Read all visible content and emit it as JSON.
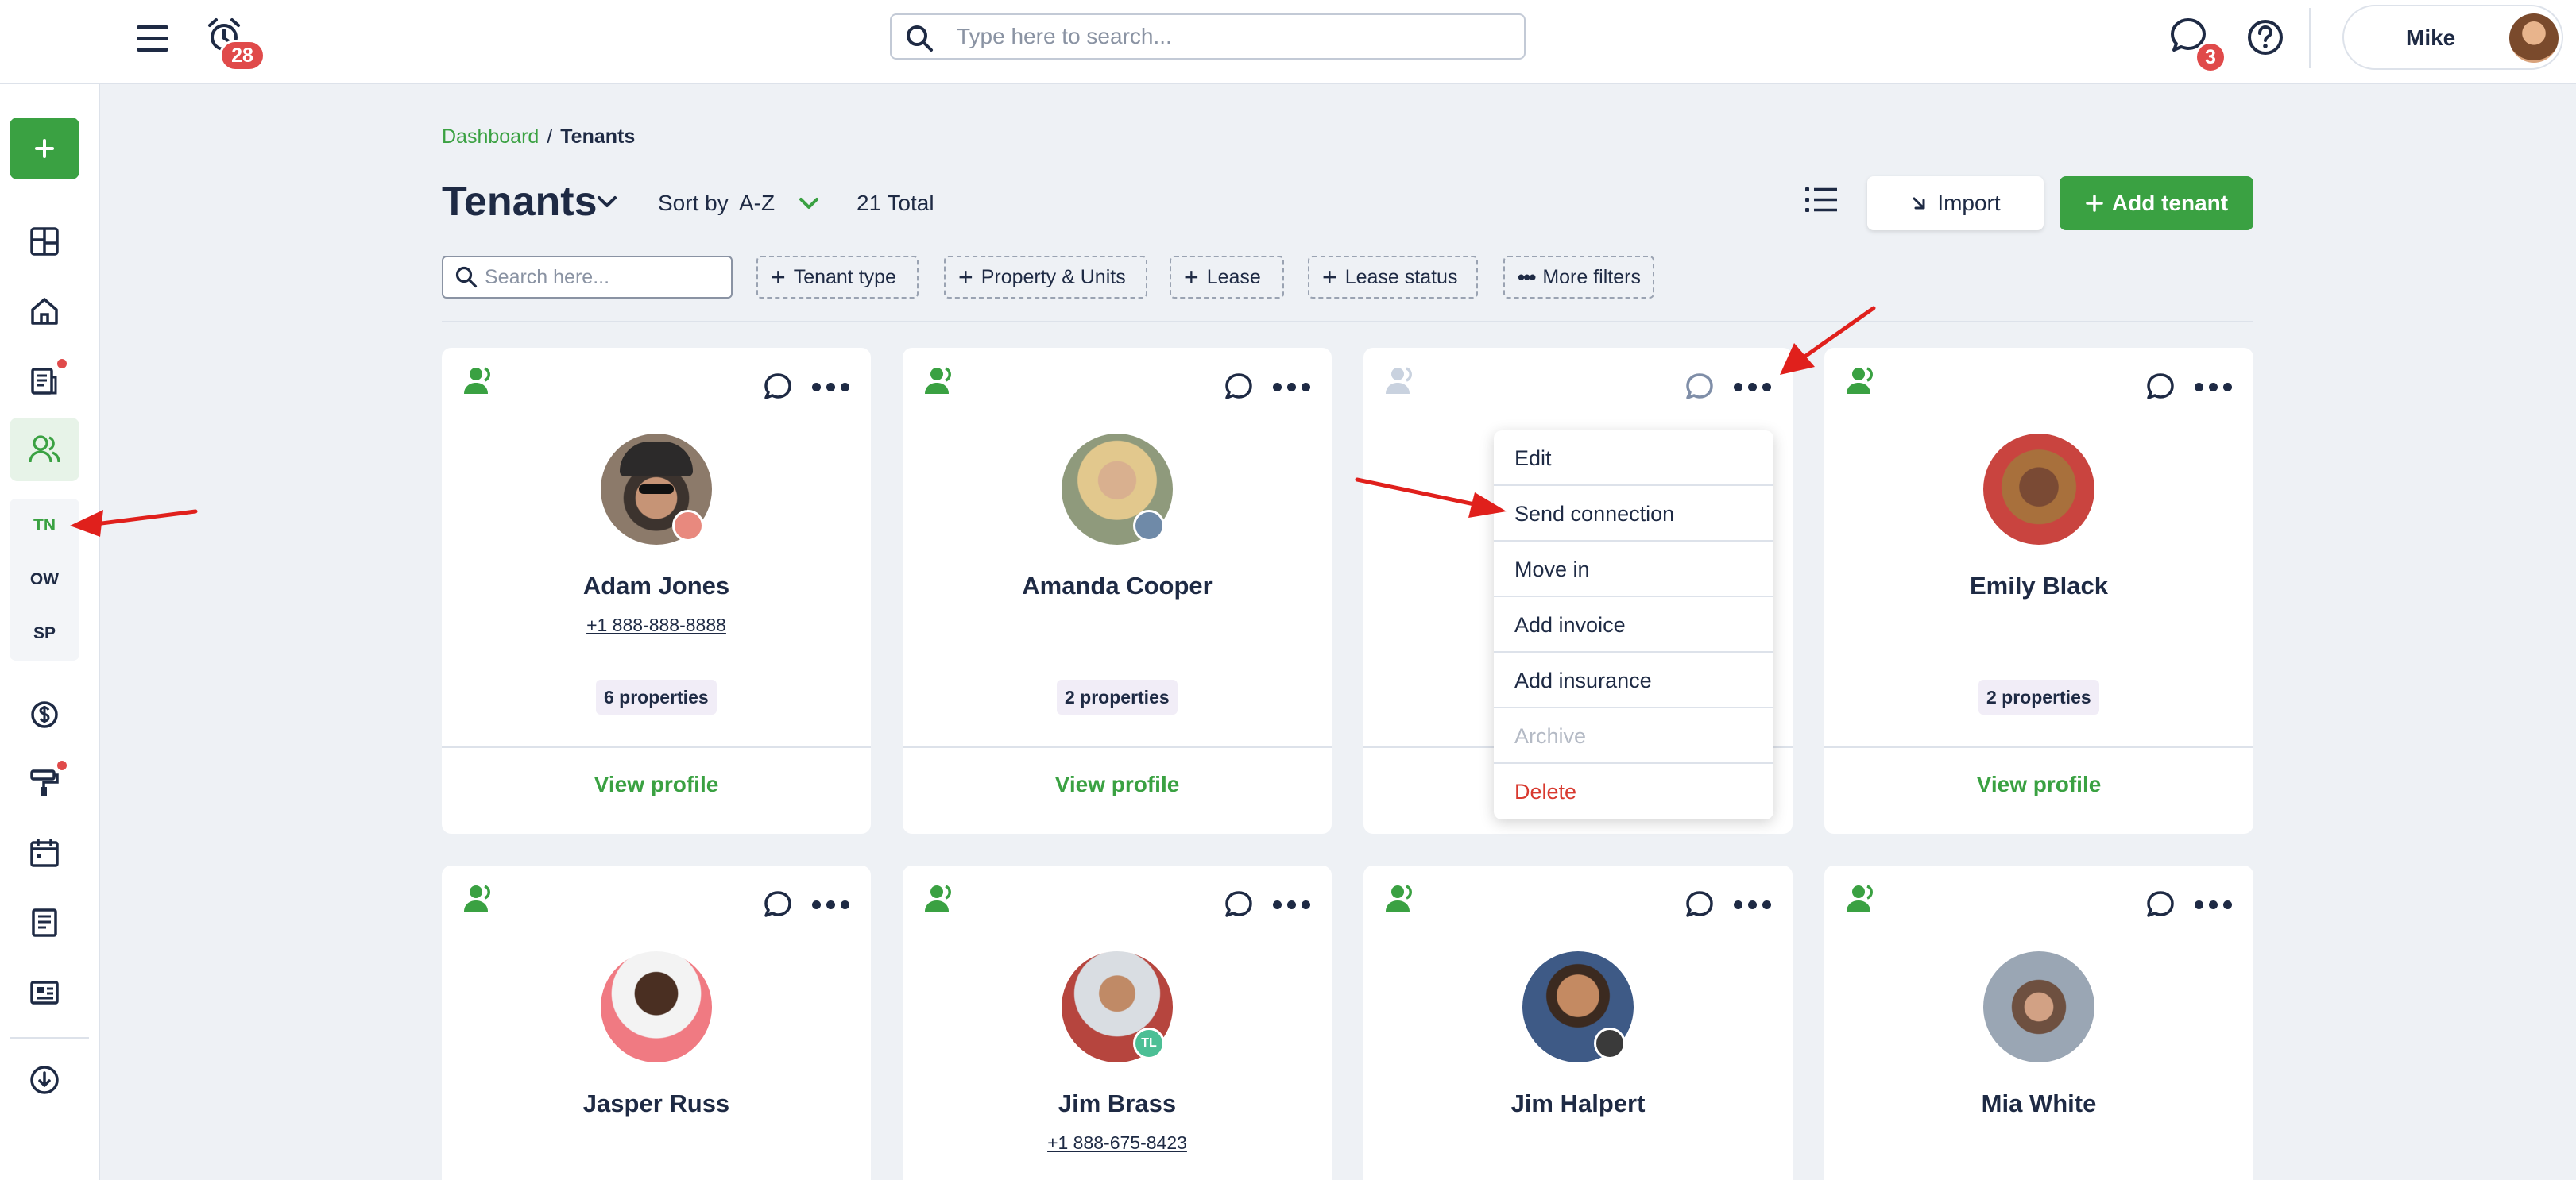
{
  "topbar": {
    "alarm_count": "28",
    "search_placeholder": "Type here to search...",
    "messages_count": "3",
    "user_name": "Mike"
  },
  "sidebar": {
    "sub_items": [
      "TN",
      "OW",
      "SP"
    ]
  },
  "breadcrumb": {
    "home": "Dashboard",
    "separator": "/",
    "current": "Tenants"
  },
  "header": {
    "title": "Tenants",
    "sort_label": "Sort by",
    "sort_value": "A-Z",
    "total": "21 Total",
    "import_label": "Import",
    "add_label": "Add tenant"
  },
  "filters": {
    "search_placeholder": "Search here...",
    "chips": [
      "Tenant type",
      "Property & Units",
      "Lease",
      "Lease status",
      "More filters"
    ]
  },
  "cards": [
    {
      "name": "Adam Jones",
      "phone": "+1 888-888-8888",
      "properties": "6 properties",
      "view": "View profile"
    },
    {
      "name": "Amanda Cooper",
      "phone": "",
      "properties": "2 properties",
      "view": "View profile"
    },
    {
      "name": "",
      "phone": "",
      "properties": "",
      "view": ""
    },
    {
      "name": "Emily Black",
      "phone": "",
      "properties": "2 properties",
      "view": "View profile"
    },
    {
      "name": "Jasper Russ",
      "phone": ""
    },
    {
      "name": "Jim Brass",
      "phone": "+1 888-675-8423",
      "avatar_badge": "TL"
    },
    {
      "name": "Jim Halpert",
      "phone": ""
    },
    {
      "name": "Mia White",
      "phone": ""
    }
  ],
  "menu": {
    "items": [
      "Edit",
      "Send connection",
      "Move in",
      "Add invoice",
      "Add insurance",
      "Archive",
      "Delete"
    ]
  },
  "colors": {
    "accent": "#3aa142",
    "badge": "#e04a4a",
    "danger": "#d8392f",
    "text": "#1e2a44",
    "background": "#eef1f5",
    "annotation_arrow": "#e0201c"
  }
}
